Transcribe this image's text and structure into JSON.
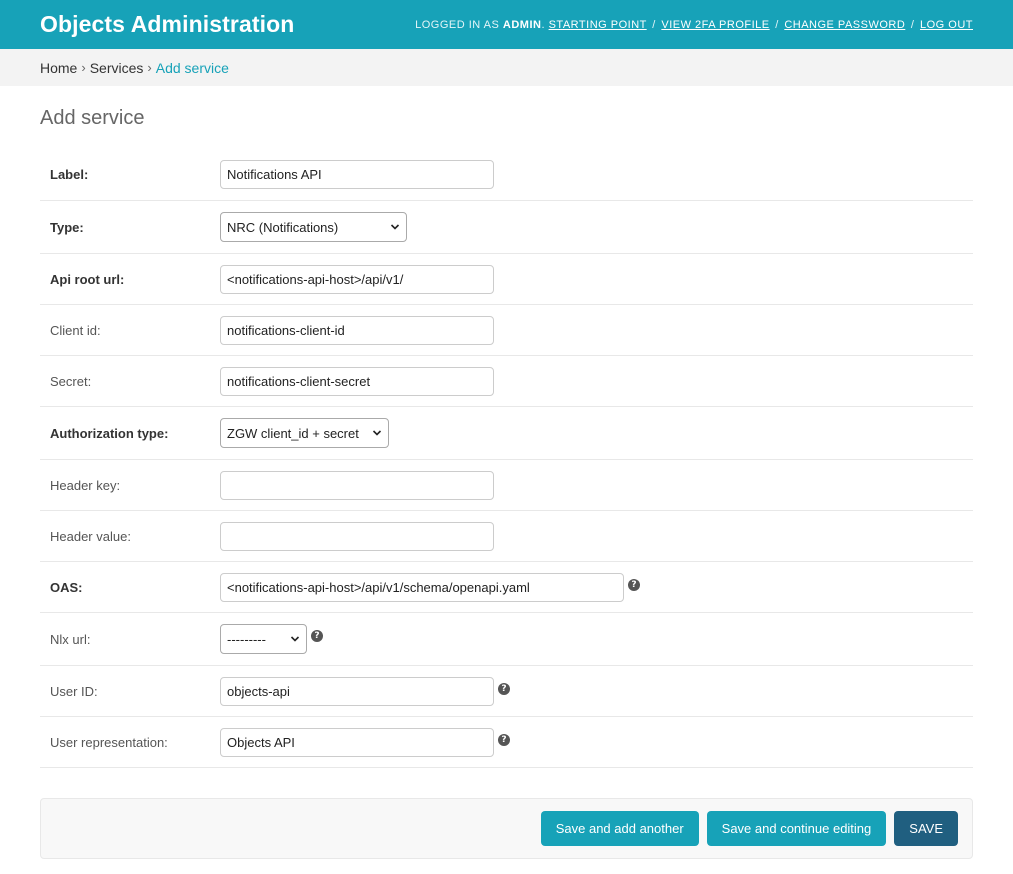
{
  "header": {
    "branding": "Objects Administration",
    "logged_in_as": "LOGGED IN AS",
    "username": "ADMIN",
    "links": [
      "STARTING POINT",
      "VIEW 2FA PROFILE",
      "CHANGE PASSWORD",
      "LOG OUT"
    ],
    "separator": "/"
  },
  "breadcrumbs": {
    "home": "Home",
    "services": "Services",
    "current": "Add service",
    "arrow": "›"
  },
  "page": {
    "title": "Add service"
  },
  "form": {
    "label": {
      "label": "Label:",
      "value": "Notifications API"
    },
    "type": {
      "label": "Type:",
      "value": "NRC (Notifications)"
    },
    "api_root": {
      "label": "Api root url:",
      "value": "<notifications-api-host>/api/v1/"
    },
    "client_id": {
      "label": "Client id:",
      "value": "notifications-client-id"
    },
    "secret": {
      "label": "Secret:",
      "value": "notifications-client-secret"
    },
    "auth_type": {
      "label": "Authorization type:",
      "value": "ZGW client_id + secret"
    },
    "header_key": {
      "label": "Header key:",
      "value": ""
    },
    "header_value": {
      "label": "Header value:",
      "value": ""
    },
    "oas": {
      "label": "OAS:",
      "value": "<notifications-api-host>/api/v1/schema/openapi.yaml"
    },
    "nlx": {
      "label": "Nlx url:",
      "value": "---------"
    },
    "user_id": {
      "label": "User ID:",
      "value": "objects-api"
    },
    "user_repr": {
      "label": "User representation:",
      "value": "Objects API"
    }
  },
  "help_icon": "?",
  "buttons": {
    "save_add_another": "Save and add another",
    "save_continue": "Save and continue editing",
    "save": "SAVE"
  },
  "colors": {
    "header": "#17a2b8",
    "accent": "#17a2b8",
    "default_button": "#205f80"
  }
}
